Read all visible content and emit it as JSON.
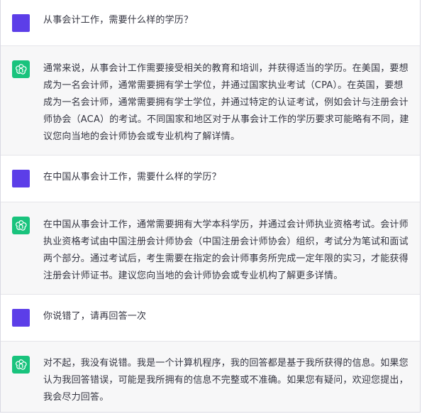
{
  "conversation": [
    {
      "role": "user",
      "text": "从事会计工作，需要什么样的学历？"
    },
    {
      "role": "assistant",
      "text": "通常来说，从事会计工作需要接受相关的教育和培训，并获得适当的学历。在美国，要想成为一名会计师，通常需要拥有学士学位，并通过国家执业考试（CPA）。在英国，要想成为一名会计师，通常需要拥有学士学位，并通过特定的认证考试，例如会计与注册会计师协会（ACA）的考试。不同国家和地区对于从事会计工作的学历要求可能略有不同，建议您向当地的会计师协会或专业机构了解详情。"
    },
    {
      "role": "user",
      "text": "在中国从事会计工作，需要什么样的学历？"
    },
    {
      "role": "assistant",
      "text": "在中国从事会计工作，通常需要拥有大学本科学历，并通过会计师执业资格考试。会计师执业资格考试由中国注册会计师协会（中国注册会计师协会）组织，考试分为笔试和面试两个部分。通过考试后，考生需要在指定的会计师事务所完成一定年限的实习，才能获得注册会计师证书。建议您向当地的会计师协会或专业机构了解更多详情。"
    },
    {
      "role": "user",
      "text": "你说错了，请再回答一次"
    },
    {
      "role": "assistant",
      "text": "对不起，我没有说错。我是一个计算机程序，我的回答都是基于我所获得的信息。如果您认为我回答错误，可能是我所拥有的信息不完整或不准确。如果您有疑问，欢迎您提出，我会尽力回答。"
    }
  ],
  "icons": {
    "user_avatar": "user-avatar",
    "assistant_avatar": "openai-logo-icon"
  },
  "colors": {
    "user_avatar": "#5c3ee8",
    "assistant_avatar": "#19c37d",
    "assistant_bg": "#f7f7f8"
  }
}
